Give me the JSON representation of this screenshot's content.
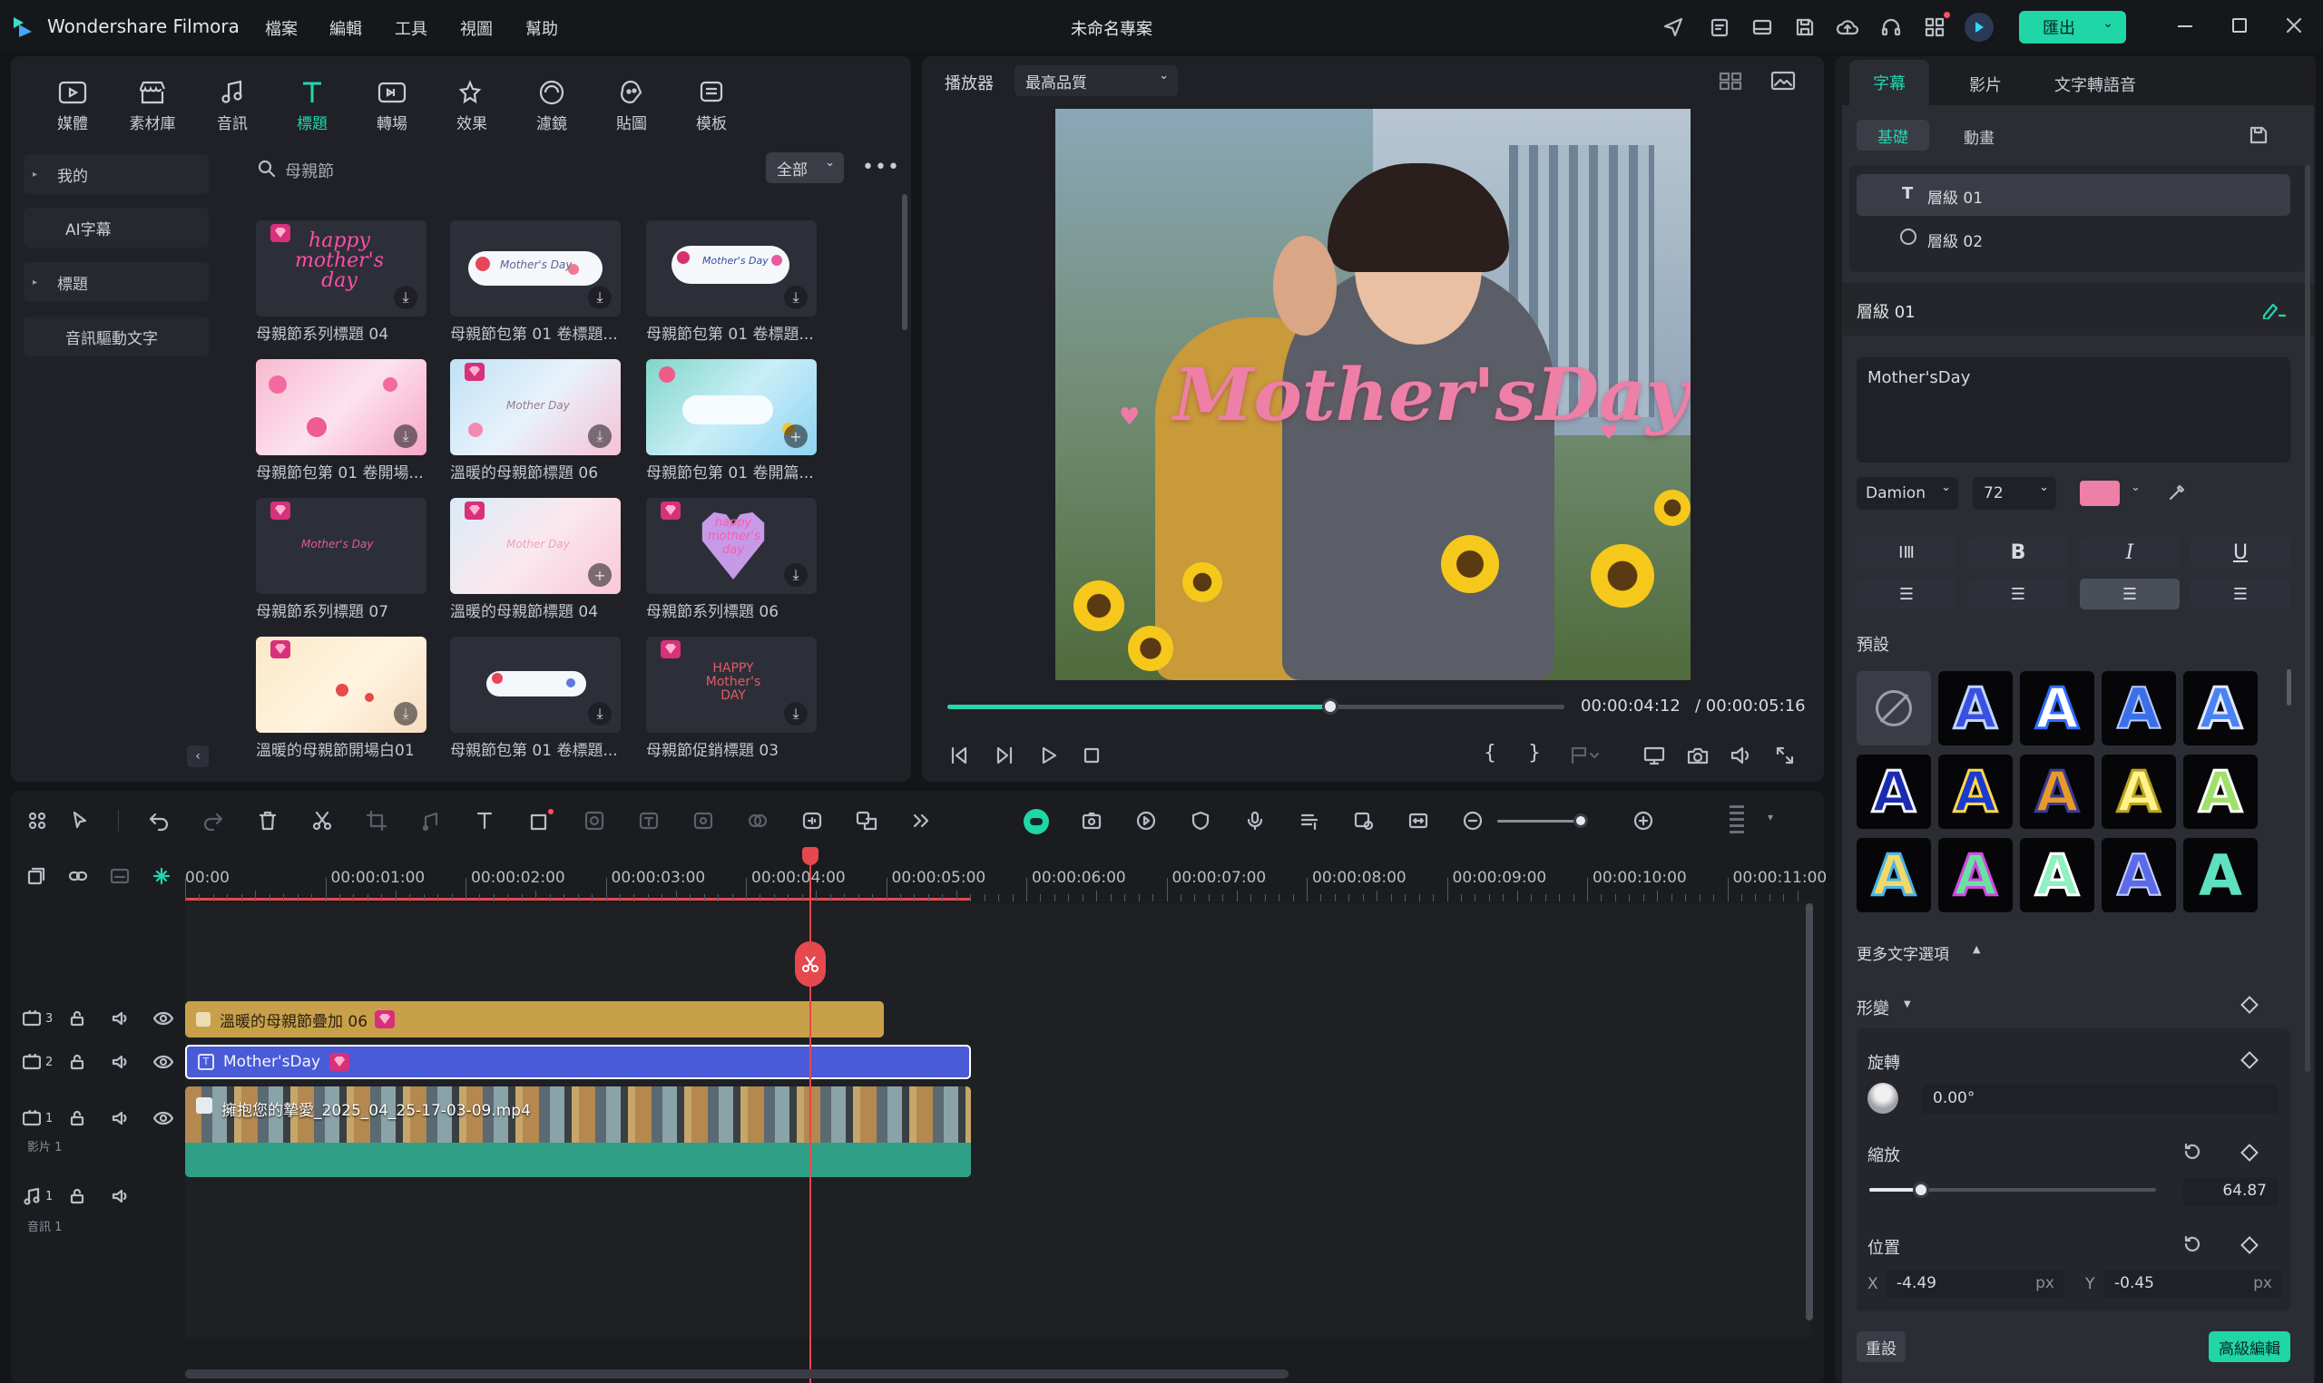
{
  "app": {
    "name": "Wondershare Filmora",
    "project_title": "未命名專案",
    "export_label": "匯出"
  },
  "menu": [
    "檔案",
    "編輯",
    "工具",
    "視圖",
    "幫助"
  ],
  "library": {
    "tabs": [
      "媒體",
      "素材庫",
      "音訊",
      "標題",
      "轉場",
      "效果",
      "濾鏡",
      "貼圖",
      "模板"
    ],
    "active_tab": "標題",
    "categories": [
      "我的",
      "AI字幕",
      "標題",
      "音訊驅動文字"
    ],
    "search_placeholder": "母親節",
    "filter_label": "全部",
    "items": [
      {
        "label": "母親節系列標題 04",
        "text": "happy mother's day"
      },
      {
        "label": "母親節包第 01 卷標題...",
        "text": "Mother's Day"
      },
      {
        "label": "母親節包第 01 卷標題...",
        "text": "Mother's Day"
      },
      {
        "label": "母親節包第 01 卷開場...",
        "text": ""
      },
      {
        "label": "溫暖的母親節標題 06",
        "text": "Mother Day"
      },
      {
        "label": "母親節包第 01 卷開篇...",
        "text": ""
      },
      {
        "label": "母親節系列標題 07",
        "text": "Mother's Day"
      },
      {
        "label": "溫暖的母親節標題 04",
        "text": "Mother Day"
      },
      {
        "label": "母親節系列標題 06",
        "text": "happy mother's day"
      },
      {
        "label": "溫暖的母親節開場白01",
        "text": ""
      },
      {
        "label": "母親節包第 01 卷標題...",
        "text": ""
      },
      {
        "label": "母親節促銷標題 03",
        "text": "HAPPY Mother's DAY"
      }
    ]
  },
  "player": {
    "label": "播放器",
    "quality": "最高品質",
    "overlay_text": "Mother'sDay",
    "current_time": "00:00:04:12",
    "total_time": "/ 00:00:05:16",
    "progress": 0.62
  },
  "timeline": {
    "ruler": [
      "00:00",
      "00:00:01:00",
      "00:00:02:00",
      "00:00:03:00",
      "00:00:04:00",
      "00:00:05:00",
      "00:00:06:00",
      "00:00:07:00",
      "00:00:08:00",
      "00:00:09:00",
      "00:00:10:00",
      "00:00:11:00"
    ],
    "tracks": [
      {
        "num": "3",
        "clip": "溫暖的母親節疊加 06"
      },
      {
        "num": "2",
        "clip": "Mother'sDay"
      },
      {
        "num": "1",
        "clip": "擁抱您的摯愛_2025_04_25-17-03-09.mp4",
        "sub": "影片 1"
      },
      {
        "num": "1",
        "clip": "",
        "sub": "音訊 1"
      }
    ]
  },
  "inspector": {
    "tabs": [
      "字幕",
      "影片",
      "文字轉語音"
    ],
    "subtabs": [
      "基礎",
      "動畫"
    ],
    "layers": [
      "層級 01",
      "層級 02"
    ],
    "layer_header": "層級 01",
    "text_value": "Mother'sDay",
    "font": "Damion",
    "font_size": "72",
    "color": "#ee7fa6",
    "format": [
      "B",
      "I",
      "U"
    ],
    "preset_label": "預設",
    "more_options": "更多文字選項",
    "transform_label": "形變",
    "rotate_label": "旋轉",
    "rotate_value": "0.00°",
    "scale_label": "縮放",
    "scale_value": "64.87",
    "position_label": "位置",
    "pos_x_label": "X",
    "pos_x": "-4.49",
    "pos_y_label": "Y",
    "pos_y": "-0.45",
    "unit": "px",
    "reset_label": "重設",
    "advanced_label": "高級編輯"
  }
}
